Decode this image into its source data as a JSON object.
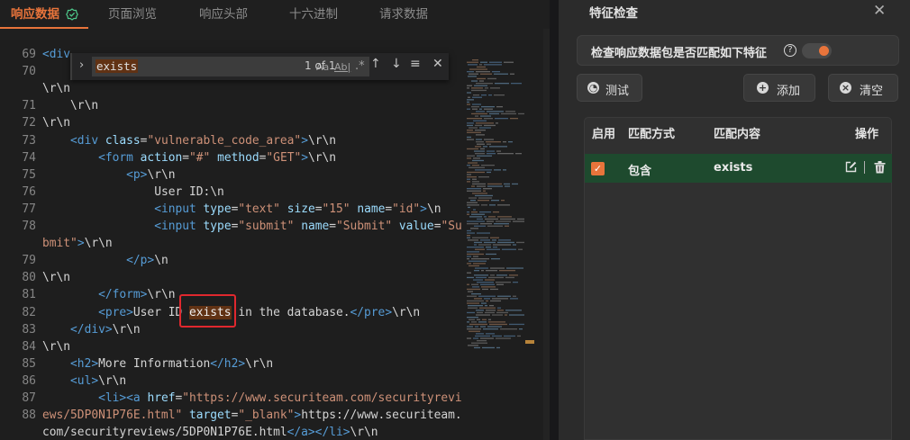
{
  "tabs": [
    "响应数据",
    "页面浏览",
    "响应头部",
    "十六进制",
    "请求数据"
  ],
  "find": {
    "term": "exists",
    "match_case": "Aa",
    "whole_word": "Ab|",
    "regex": ".*",
    "count": "1 of 1"
  },
  "code": {
    "lines": [
      {
        "n": "69",
        "html": "<span class='tag'>&lt;div</span>"
      },
      {
        "n": "70",
        "html": ""
      },
      {
        "n": "",
        "html": "<span class='txt'>\\r\\n</span>"
      },
      {
        "n": "71",
        "html": "    <span class='txt'>\\r\\n</span>"
      },
      {
        "n": "72",
        "html": "<span class='txt'>\\r\\n</span>"
      },
      {
        "n": "73",
        "html": "    <span class='tag'>&lt;div</span> <span class='attr'>class</span>=<span class='str'>\"vulnerable_code_area\"</span><span class='tag'>&gt;</span><span class='txt'>\\r\\n</span>"
      },
      {
        "n": "74",
        "html": "        <span class='tag'>&lt;form</span> <span class='attr'>action</span>=<span class='str'>\"#\"</span> <span class='attr'>method</span>=<span class='str'>\"GET\"</span><span class='tag'>&gt;</span><span class='txt'>\\r\\n</span>"
      },
      {
        "n": "75",
        "html": "            <span class='tag'>&lt;p&gt;</span><span class='txt'>\\r\\n</span>"
      },
      {
        "n": "76",
        "html": "                <span class='txt'>User ID:\\n</span>"
      },
      {
        "n": "77",
        "html": "                <span class='tag'>&lt;input</span> <span class='attr'>type</span>=<span class='str'>\"text\"</span> <span class='attr'>size</span>=<span class='str'>\"15\"</span> <span class='attr'>name</span>=<span class='str'>\"id\"</span><span class='tag'>&gt;</span><span class='txt'>\\n</span>"
      },
      {
        "n": "78",
        "html": "                <span class='tag'>&lt;input</span> <span class='attr'>type</span>=<span class='str'>\"submit\"</span> <span class='attr'>name</span>=<span class='str'>\"Submit\"</span> <span class='attr'>value</span>=<span class='str'>\"Su</span>"
      },
      {
        "n": "",
        "html": "<span class='str'>bmit\"</span><span class='tag'>&gt;</span><span class='txt'>\\r\\n</span>"
      },
      {
        "n": "79",
        "html": "            <span class='tag'>&lt;/p&gt;</span><span class='txt'>\\n</span>"
      },
      {
        "n": "80",
        "html": "<span class='txt'>\\r\\n</span>"
      },
      {
        "n": "81",
        "html": "        <span class='tag'>&lt;/form&gt;</span><span class='txt'>\\r\\n</span>"
      },
      {
        "n": "82",
        "html": "        <span class='tag'>&lt;pre&gt;</span><span class='txt'>User ID </span><span class='hl'>exists</span><span class='txt'> in the database.</span><span class='tag'>&lt;/pre&gt;</span><span class='txt'>\\r\\n</span>"
      },
      {
        "n": "83",
        "html": "    <span class='tag'>&lt;/div&gt;</span><span class='txt'>\\r\\n</span>"
      },
      {
        "n": "84",
        "html": "<span class='txt'>\\r\\n</span>"
      },
      {
        "n": "85",
        "html": "    <span class='tag'>&lt;h2&gt;</span><span class='txt'>More Information</span><span class='tag'>&lt;/h2&gt;</span><span class='txt'>\\r\\n</span>"
      },
      {
        "n": "86",
        "html": "    <span class='tag'>&lt;ul&gt;</span><span class='txt'>\\r\\n</span>"
      },
      {
        "n": "87",
        "html": "        <span class='tag'>&lt;li&gt;&lt;a</span> <span class='attr'>href</span>=<span class='str'>\"https://www.securiteam.com/securityrevi</span>"
      },
      {
        "n": "88",
        "html": "<span class='str'>ews/5DP0N1P76E.html\"</span> <span class='attr'>target</span>=<span class='str'>\"_blank\"</span><span class='tag'>&gt;</span><span class='txt'>https://www.securiteam.</span>"
      },
      {
        "n": "",
        "html": "<span class='txt'>com/securityreviews/5DP0N1P76E.html</span><span class='tag'>&lt;/a&gt;&lt;/li&gt;</span><span class='txt'>\\r\\n</span>"
      }
    ]
  },
  "panel": {
    "title": "特征检查",
    "header_label": "检查响应数据包是否匹配如下特征",
    "toggle_on": true,
    "buttons": {
      "test": "测试",
      "add": "添加",
      "clear": "清空"
    },
    "columns": [
      "启用",
      "匹配方式",
      "匹配内容",
      "操作"
    ],
    "rows": [
      {
        "enabled": true,
        "method": "包含",
        "content": "exists"
      }
    ]
  },
  "colors": {
    "accent": "#e8743b",
    "row_bg": "#1e4a2e",
    "highlight": "#613214",
    "callout": "#e0282e"
  }
}
